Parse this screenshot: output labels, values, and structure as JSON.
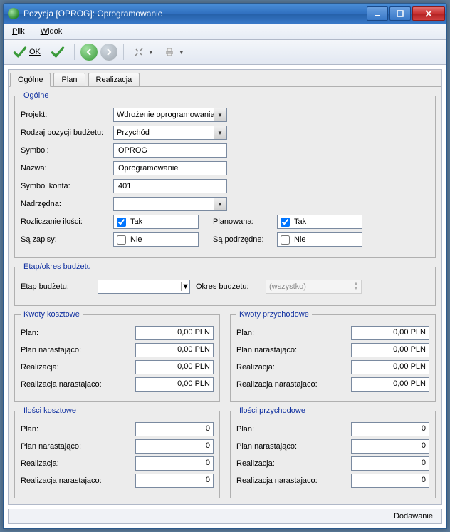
{
  "window": {
    "title": "Pozycja [OPROG]: Oprogramowanie"
  },
  "menu": {
    "plik": "Plik",
    "widok": "Widok"
  },
  "toolbar": {
    "ok": "OK"
  },
  "tabs": {
    "general": "Ogólne",
    "plan": "Plan",
    "realizacja": "Realizacja"
  },
  "general": {
    "legend": "Ogólne",
    "projekt_label": "Projekt:",
    "projekt_value": "Wdrożenie oprogramowania",
    "rodzaj_label": "Rodzaj pozycji budżetu:",
    "rodzaj_value": "Przychód",
    "symbol_label": "Symbol:",
    "symbol_value": "OPROG",
    "nazwa_label": "Nazwa:",
    "nazwa_value": "Oprogramowanie",
    "konto_label": "Symbol konta:",
    "konto_value": "401",
    "nadrzedna_label": "Nadrzędna:",
    "nadrzedna_value": "",
    "rozliczanie_label": "Rozliczanie ilości:",
    "rozliczanie_text": "Tak",
    "planowana_label": "Planowana:",
    "planowana_text": "Tak",
    "zapisy_label": "Są zapisy:",
    "zapisy_text": "Nie",
    "podrzedne_label": "Są podrzędne:",
    "podrzedne_text": "Nie"
  },
  "etap": {
    "legend": "Etap/okres budżetu",
    "etap_label": "Etap budżetu:",
    "okres_label": "Okres budżetu:",
    "okres_value": "(wszystko)"
  },
  "kwoty_koszt": {
    "legend": "Kwoty kosztowe",
    "plan_label": "Plan:",
    "plan_value": "0,00 PLN",
    "plan_nar_label": "Plan narastająco:",
    "plan_nar_value": "0,00 PLN",
    "real_label": "Realizacja:",
    "real_value": "0,00 PLN",
    "real_nar_label": "Realizacja narastajaco:",
    "real_nar_value": "0,00 PLN"
  },
  "kwoty_przych": {
    "legend": "Kwoty przychodowe",
    "plan_label": "Plan:",
    "plan_value": "0,00 PLN",
    "plan_nar_label": "Plan narastająco:",
    "plan_nar_value": "0,00 PLN",
    "real_label": "Realizacja:",
    "real_value": "0,00 PLN",
    "real_nar_label": "Realizacja narastajaco:",
    "real_nar_value": "0,00 PLN"
  },
  "ilosci_koszt": {
    "legend": "Ilości kosztowe",
    "plan_label": "Plan:",
    "plan_value": "0",
    "plan_nar_label": "Plan narastająco:",
    "plan_nar_value": "0",
    "real_label": "Realizacja:",
    "real_value": "0",
    "real_nar_label": "Realizacja narastajaco:",
    "real_nar_value": "0"
  },
  "ilosci_przych": {
    "legend": "Ilości przychodowe",
    "plan_label": "Plan:",
    "plan_value": "0",
    "plan_nar_label": "Plan narastająco:",
    "plan_nar_value": "0",
    "real_label": "Realizacja:",
    "real_value": "0",
    "real_nar_label": "Realizacja narastajaco:",
    "real_nar_value": "0"
  },
  "status": "Dodawanie"
}
